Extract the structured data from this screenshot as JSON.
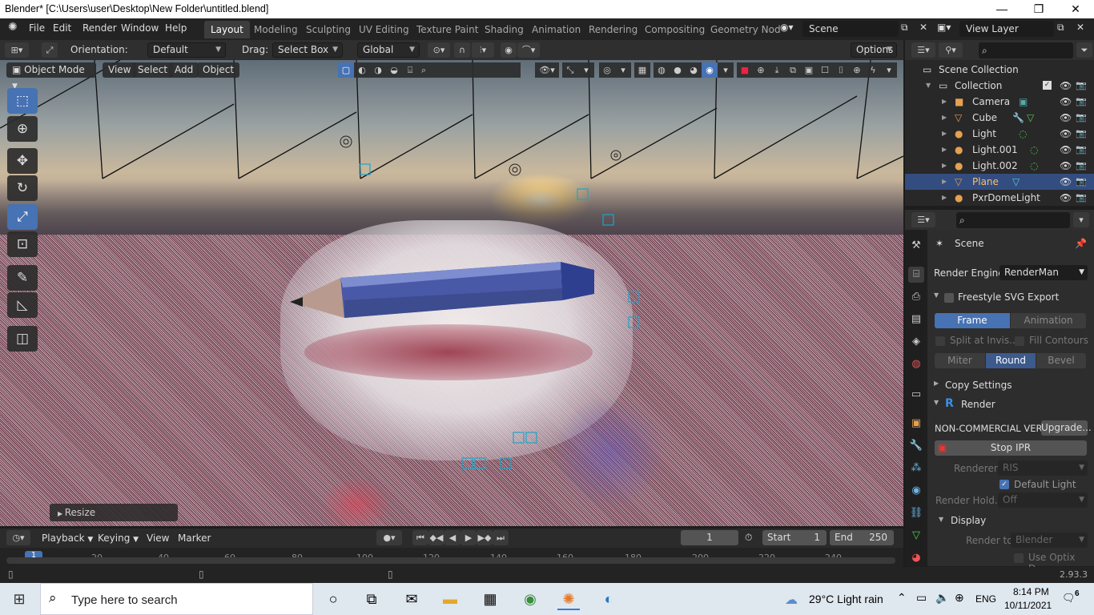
{
  "window": {
    "title": "Blender* [C:\\Users\\user\\Desktop\\New Folder\\untitled.blend]",
    "minimize": "—",
    "maximize": "❐",
    "close": "✕"
  },
  "menubar": {
    "items": [
      "File",
      "Edit",
      "Render",
      "Window",
      "Help"
    ],
    "workspaces": [
      "Layout",
      "Modeling",
      "Sculpting",
      "UV Editing",
      "Texture Paint",
      "Shading",
      "Animation",
      "Rendering",
      "Compositing",
      "Geometry Nod"
    ],
    "active_workspace": "Layout",
    "scene": "Scene",
    "view_layer": "View Layer"
  },
  "tool_header": {
    "orientation_label": "Orientation:",
    "orientation_value": "Default",
    "drag_label": "Drag:",
    "drag_value": "Select Box",
    "transform_orientation": "Global",
    "options_label": "Options"
  },
  "viewport_header": {
    "mode": "Object Mode",
    "menus": [
      "View",
      "Select",
      "Add",
      "Object"
    ]
  },
  "viewport": {
    "operator_panel": "Resize"
  },
  "outliner": {
    "root": "Scene Collection",
    "collection": "Collection",
    "objects": [
      {
        "name": "Camera",
        "icon": "camera-icon",
        "color": "#e6a050"
      },
      {
        "name": "Cube",
        "icon": "mesh-icon",
        "color": "#e6a050"
      },
      {
        "name": "Light",
        "icon": "light-icon",
        "color": "#e6a050"
      },
      {
        "name": "Light.001",
        "icon": "light-icon",
        "color": "#e6a050"
      },
      {
        "name": "Light.002",
        "icon": "light-icon",
        "color": "#e6a050"
      },
      {
        "name": "Plane",
        "icon": "mesh-icon",
        "color": "#e6a050",
        "selected": true
      },
      {
        "name": "PxrDomeLight",
        "icon": "light-icon",
        "color": "#e6a050"
      }
    ]
  },
  "properties": {
    "scene_name": "Scene",
    "render_engine_label": "Render Engine",
    "render_engine": "RenderMan",
    "freestyle_svg": "Freestyle SVG Export",
    "frame": "Frame",
    "animation": "Animation",
    "split_at_invis": "Split at Invis...",
    "fill_contours": "Fill Contours",
    "miter": "Miter",
    "round": "Round",
    "bevel": "Bevel",
    "copy_settings": "Copy Settings",
    "render_section": "Render",
    "noncommercial": "NON-COMMERCIAL VER...",
    "upgrade": "Upgrade...",
    "stop_ipr": "Stop IPR",
    "renderer_label": "Renderer",
    "renderer_value": "RIS",
    "default_light": "Default Light",
    "render_hold_label": "Render Hold...",
    "render_hold_value": "Off",
    "display_section": "Display",
    "render_to_label": "Render to",
    "render_to_value": "Blender",
    "use_optix": "Use Optix D..."
  },
  "timeline": {
    "menus": [
      "Playback",
      "Keying",
      "View",
      "Marker"
    ],
    "current_frame": "1",
    "start_label": "Start",
    "start": "1",
    "end_label": "End",
    "end": "250",
    "ticks": [
      "1",
      "20",
      "40",
      "60",
      "80",
      "100",
      "120",
      "140",
      "160",
      "180",
      "200",
      "220",
      "240"
    ]
  },
  "statusbar": {
    "version": "2.93.3"
  },
  "taskbar": {
    "search_placeholder": "Type here to search",
    "weather": "29°C  Light rain",
    "language": "ENG",
    "time": "8:14 PM",
    "date": "10/11/2021",
    "notifications": "6"
  }
}
